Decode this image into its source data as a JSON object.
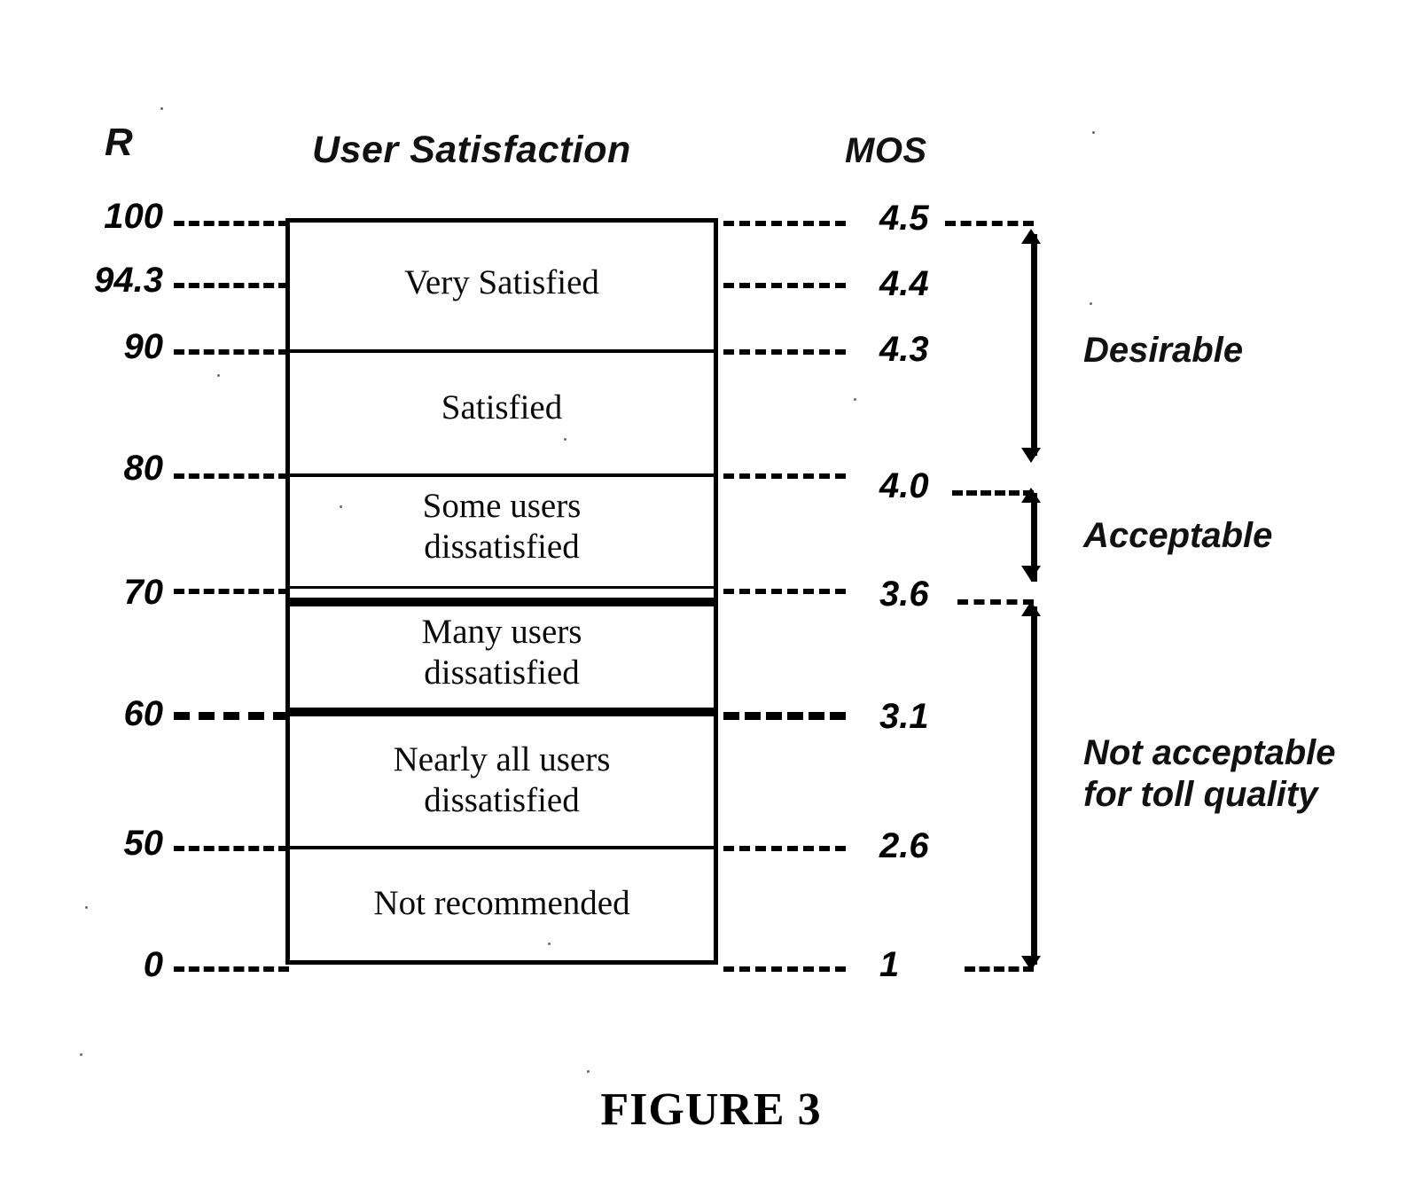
{
  "figure": {
    "caption": "FIGURE 3"
  },
  "headers": {
    "r": "R",
    "user_satisfaction": "User Satisfaction",
    "mos": "MOS"
  },
  "chart_data": {
    "type": "table",
    "title": "User Satisfaction",
    "xlabel": "",
    "ylabel": "R",
    "ylim": [
      0,
      100
    ],
    "left_axis": {
      "name": "R",
      "ticks": [
        "100",
        "94.3",
        "90",
        "80",
        "70",
        "60",
        "50",
        "0"
      ],
      "values": [
        100,
        94.3,
        90,
        80,
        70,
        60,
        50,
        0
      ]
    },
    "right_axis": {
      "name": "MOS",
      "ticks": [
        "4.5",
        "4.4",
        "4.3",
        "4.0",
        "3.6",
        "3.1",
        "2.6",
        "1"
      ],
      "values": [
        4.5,
        4.4,
        4.3,
        4.0,
        3.6,
        3.1,
        2.6,
        1.0
      ]
    },
    "bands": [
      {
        "label": "Very Satisfied",
        "r_range": [
          90,
          100
        ],
        "mos_range": [
          4.3,
          4.5
        ]
      },
      {
        "label": "Satisfied",
        "r_range": [
          80,
          90
        ],
        "mos_range": [
          4.0,
          4.3
        ]
      },
      {
        "label": "Some users\ndissatisfied",
        "r_range": [
          70,
          80
        ],
        "mos_range": [
          3.6,
          4.0
        ]
      },
      {
        "label": "Many users\ndissatisfied",
        "r_range": [
          60,
          70
        ],
        "mos_range": [
          3.1,
          3.6
        ]
      },
      {
        "label": "Nearly all  users\ndissatisfied",
        "r_range": [
          50,
          60
        ],
        "mos_range": [
          2.6,
          3.1
        ]
      },
      {
        "label": "Not recommended",
        "r_range": [
          0,
          50
        ],
        "mos_range": [
          1.0,
          2.6
        ]
      }
    ],
    "quality_brackets": [
      {
        "label": "Desirable",
        "mos_range": [
          4.0,
          4.5
        ],
        "r_range": [
          80,
          100
        ]
      },
      {
        "label": "Acceptable",
        "mos_range": [
          3.6,
          4.0
        ],
        "r_range": [
          70,
          80
        ]
      },
      {
        "label": "Not acceptable\nfor toll quality",
        "mos_range": [
          1.0,
          3.6
        ],
        "r_range": [
          0,
          70
        ]
      }
    ]
  },
  "ticks": {
    "r": {
      "t100": "100",
      "t943": "94.3",
      "t90": "90",
      "t80": "80",
      "t70": "70",
      "t60": "60",
      "t50": "50",
      "t0": "0"
    },
    "mos": {
      "t45": "4.5",
      "t44": "4.4",
      "t43": "4.3",
      "t40": "4.0",
      "t36": "3.6",
      "t31": "3.1",
      "t26": "2.6",
      "t1": "1"
    }
  },
  "bands": {
    "very_satisfied": "Very Satisfied",
    "satisfied": "Satisfied",
    "some_users": "Some users\ndissatisfied",
    "many_users": "Many users\ndissatisfied",
    "nearly_all": "Nearly all  users\ndissatisfied",
    "not_recommended": "Not recommended"
  },
  "brackets": {
    "desirable": "Desirable",
    "acceptable": "Acceptable",
    "not_acceptable": "Not acceptable\nfor toll quality"
  },
  "colors": {
    "ink": "#000000",
    "paper": "#ffffff"
  }
}
